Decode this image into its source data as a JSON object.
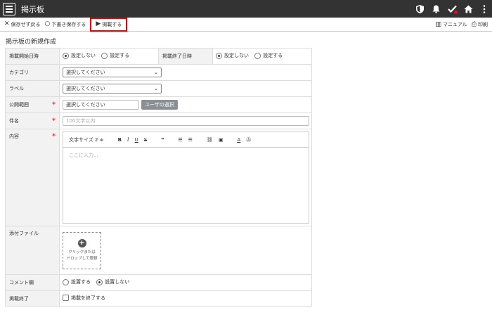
{
  "app": {
    "title": "掲示板",
    "icons": [
      "shield-icon",
      "bell-icon",
      "check-icon",
      "home-icon",
      "more-vertical-icon"
    ]
  },
  "toolbar": {
    "back_label": "保存せず戻る",
    "draft_label": "下書き保存する",
    "publish_label": "掲載する",
    "manual_label": "マニュアル",
    "print_label": "印刷",
    "highlight_color": "#ee0000"
  },
  "page_title": "掲示板の新規作成",
  "form": {
    "start": {
      "label": "掲載開始日時",
      "options": [
        "設定しない",
        "設定する"
      ],
      "selected": "設定しない"
    },
    "end": {
      "label": "掲載終了日時",
      "options": [
        "設定しない",
        "設定する"
      ],
      "selected": "設定しない"
    },
    "category": {
      "label": "カテゴリ",
      "value": "選択してください"
    },
    "label_field": {
      "label": "ラベル",
      "value": "選択してください"
    },
    "scope": {
      "label": "公開範囲",
      "value": "選択してください",
      "button": "ユーザの選択"
    },
    "subject": {
      "label": "件名",
      "placeholder": "100文字以内"
    },
    "content": {
      "label": "内容",
      "font_size": "文字サイズ 2 ≑",
      "placeholder": "ここに入力..."
    },
    "attachment": {
      "label": "添付ファイル",
      "line1": "クリックまたは",
      "line2": "ドロップして登録"
    },
    "comment": {
      "label": "コメント欄",
      "options": [
        "設置する",
        "設置しない"
      ],
      "selected": "設置しない"
    },
    "finish": {
      "label": "掲載終了",
      "checkbox": "掲載を終了する"
    }
  }
}
